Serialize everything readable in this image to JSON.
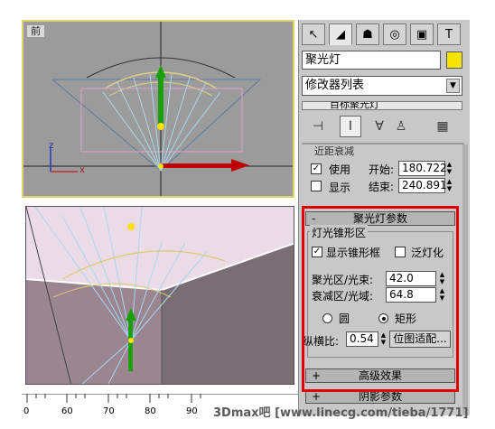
{
  "viewports": {
    "front_label": "前",
    "persp_label": ""
  },
  "axis_labels": {
    "z": "z",
    "x": "x"
  },
  "command_panel": {
    "tab_icons": [
      "create-arrow-icon",
      "modify-curve-icon",
      "hierarchy-icon",
      "motion-icon",
      "display-icon",
      "utilities-hammer-icon"
    ],
    "object_name": "聚光灯",
    "object_color": "#f5e400",
    "modifier_list": "修改器列表",
    "stack_item": "目标聚光灯"
  },
  "group_partial": {
    "title": "近距衰减",
    "use_label": "使用",
    "show_label": "显示",
    "start_label": "开始:",
    "start_value": "180.722",
    "end_label": "结束:",
    "end_value": "240.891"
  },
  "spot_params": {
    "rollout_sign": "-",
    "rollout_title": "聚光灯参数",
    "section_title": "灯光锥形区",
    "show_cone_label": "显示锥形框",
    "overshoot_label": "泛灯化",
    "hotspot_label": "聚光区/光束:",
    "hotspot_value": "42.0",
    "falloff_label": "衰减区/光域:",
    "falloff_value": "64.8",
    "circle_label": "圆",
    "rect_label": "矩形",
    "rect_selected": true,
    "aspect_label": "纵横比:",
    "aspect_value": "0.54",
    "bitmap_fit_label": "位图适配..."
  },
  "collapsed_rollouts": [
    {
      "sign": "+",
      "title": "高级效果"
    },
    {
      "sign": "+",
      "title": "阴影参数"
    }
  ],
  "ruler_ticks": [
    "0",
    "60",
    "70",
    "80",
    "90"
  ],
  "watermark": "3Dmax吧  [www.linecg.com/tieba/1771]",
  "highlight_color": "#e00000"
}
